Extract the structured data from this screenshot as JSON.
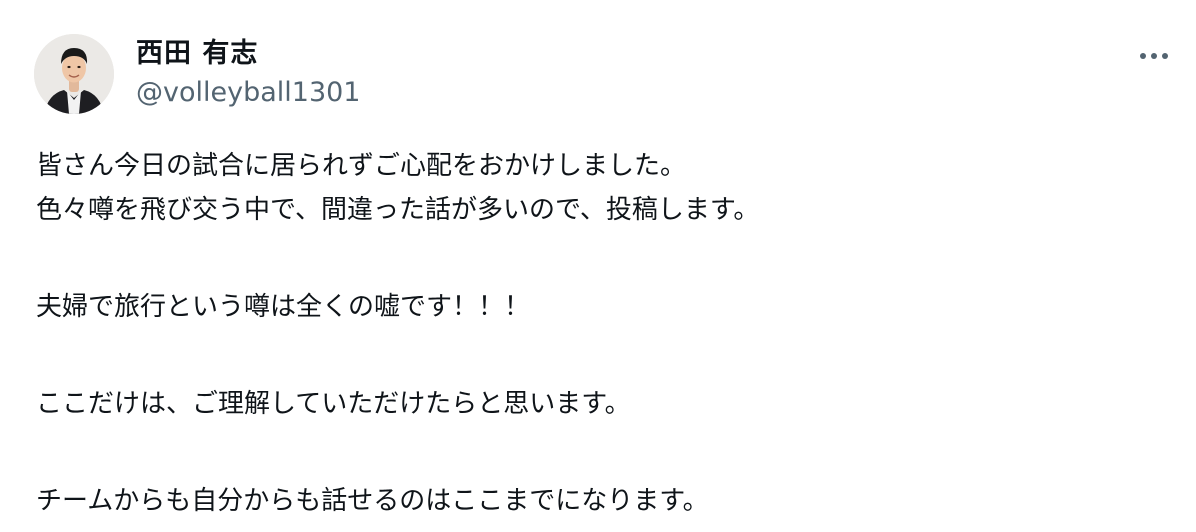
{
  "tweet": {
    "author": {
      "display_name": "西田 有志",
      "handle": "@volleyball1301"
    },
    "more_icon": "ellipsis-icon",
    "text_lines": [
      "皆さん今日の試合に居られずご心配をおかけしました。",
      "色々噂を飛び交う中で、間違った話が多いので、投稿します。",
      "夫婦で旅行という噂は全くの嘘です！！！",
      "ここだけは、ご理解していただけたらと思います。",
      "チームからも自分からも話せるのはここまでになります。"
    ]
  },
  "colors": {
    "text_primary": "#0f1419",
    "text_secondary": "#536471",
    "background": "#ffffff"
  }
}
